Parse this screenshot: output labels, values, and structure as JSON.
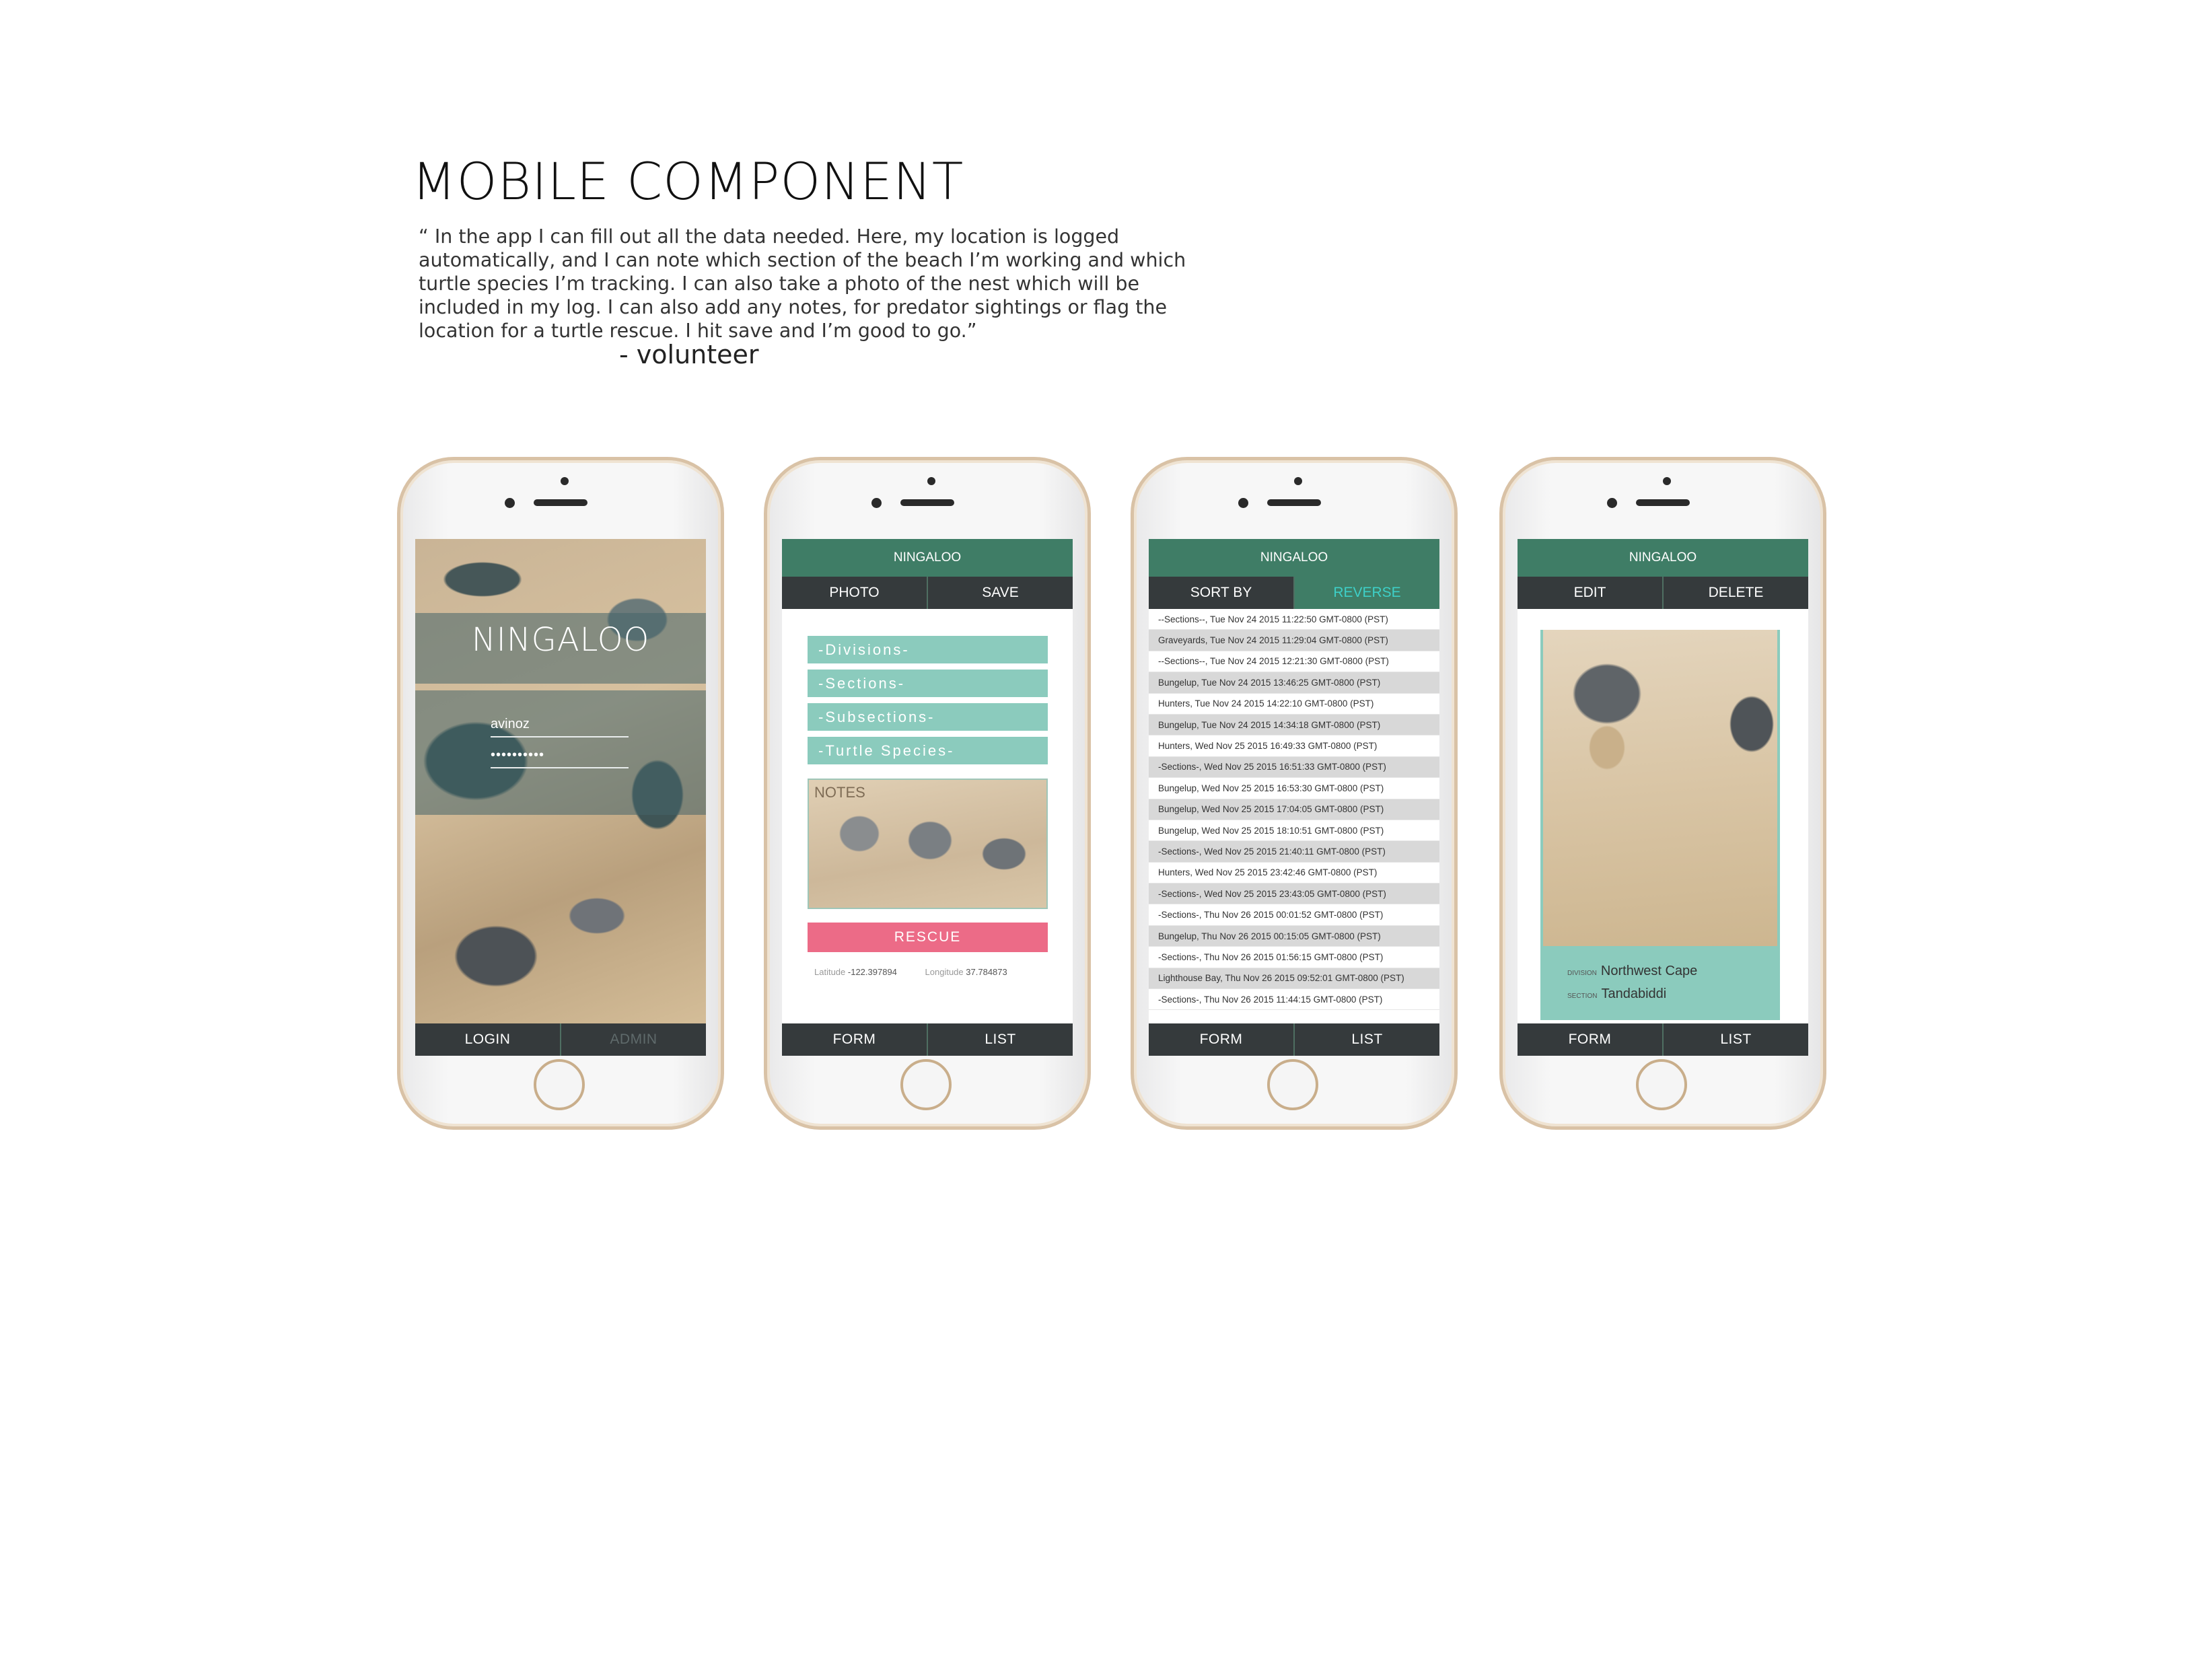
{
  "heading": "MOBILE COMPONENT",
  "quote": "“ In the app I can fill out all the data needed. Here, my location is logged automatically, and I can note which section of the beach I’m working and which turtle species I’m tracking. I can also take a photo of the nest which will be included in my log. I can also add any notes, for predator sightings or flag the location for a turtle rescue. I hit save and I’m good to go.”",
  "author": "- volunteer",
  "app_name": "NINGALOO",
  "login": {
    "username": "avinoz",
    "password": "••••••••••",
    "login_label": "LOGIN",
    "admin_label": "ADMIN"
  },
  "form": {
    "photo_label": "PHOTO",
    "save_label": "SAVE",
    "divisions": "-Divisions-",
    "sections": "-Sections-",
    "subsections": "-Subsections-",
    "species": "-Turtle Species-",
    "notes_label": "NOTES",
    "rescue_label": "RESCUE",
    "latitude_label": "Latitude",
    "latitude": "-122.397894",
    "longitude_label": "Longitude",
    "longitude": "37.784873"
  },
  "list": {
    "sort_label": "SORT BY",
    "reverse_label": "REVERSE",
    "rows": [
      "--Sections--, Tue Nov 24 2015 11:22:50 GMT-0800 (PST)",
      "Graveyards, Tue Nov 24 2015 11:29:04 GMT-0800 (PST)",
      "--Sections--, Tue Nov 24 2015 12:21:30 GMT-0800 (PST)",
      "Bungelup, Tue Nov 24 2015 13:46:25 GMT-0800 (PST)",
      "Hunters, Tue Nov 24 2015 14:22:10 GMT-0800 (PST)",
      "Bungelup, Tue Nov 24 2015 14:34:18 GMT-0800 (PST)",
      "Hunters, Wed Nov 25 2015 16:49:33 GMT-0800 (PST)",
      "-Sections-, Wed Nov 25 2015 16:51:33 GMT-0800 (PST)",
      "Bungelup, Wed Nov 25 2015 16:53:30 GMT-0800 (PST)",
      "Bungelup, Wed Nov 25 2015 17:04:05 GMT-0800 (PST)",
      "Bungelup, Wed Nov 25 2015 18:10:51 GMT-0800 (PST)",
      "-Sections-, Wed Nov 25 2015 21:40:11 GMT-0800 (PST)",
      "Hunters, Wed Nov 25 2015 23:42:46 GMT-0800 (PST)",
      "-Sections-, Wed Nov 25 2015 23:43:05 GMT-0800 (PST)",
      "-Sections-, Thu Nov 26 2015 00:01:52 GMT-0800 (PST)",
      "Bungelup, Thu Nov 26 2015 00:15:05 GMT-0800 (PST)",
      "-Sections-, Thu Nov 26 2015 01:56:15 GMT-0800 (PST)",
      "Lighthouse Bay, Thu Nov 26 2015 09:52:01 GMT-0800 (PST)",
      "-Sections-, Thu Nov 26 2015 11:44:15 GMT-0800 (PST)"
    ]
  },
  "detail": {
    "edit_label": "EDIT",
    "delete_label": "DELETE",
    "division_label": "DIVISION",
    "division": "Northwest Cape",
    "section_label": "SECTION",
    "section": "Tandabiddi"
  },
  "nav": {
    "form_label": "FORM",
    "list_label": "LIST"
  },
  "colors": {
    "header_green": "#3f7d66",
    "bar_dark": "#353a3c",
    "field_teal": "#8bcbbd",
    "rescue_pink": "#ec6b87",
    "phone_gold": "#d9c2a6"
  }
}
